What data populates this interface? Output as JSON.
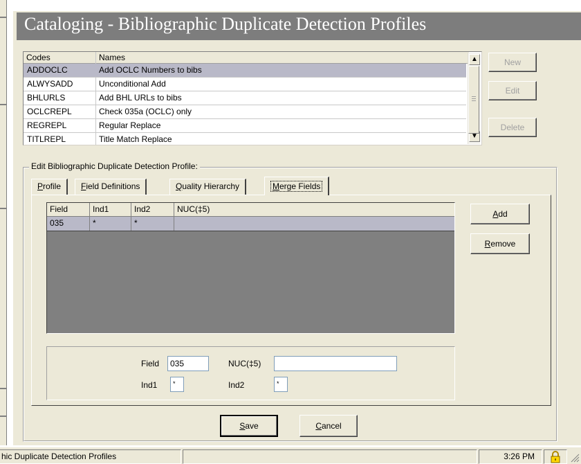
{
  "window": {
    "title": "Cataloging - Bibliographic Duplicate Detection Profiles"
  },
  "profiles_list": {
    "columns": [
      "Codes",
      "Names"
    ],
    "rows": [
      {
        "code": "ADDOCLC",
        "name": "Add OCLC Numbers to bibs",
        "selected": true
      },
      {
        "code": "ALWYSADD",
        "name": "Unconditional Add"
      },
      {
        "code": "BHLURLS",
        "name": "Add BHL URLs to bibs"
      },
      {
        "code": "OCLCREPL",
        "name": "Check 035a (OCLC) only"
      },
      {
        "code": "REGREPL",
        "name": "Regular Replace"
      },
      {
        "code": "TITLREPL",
        "name": "Title Match Replace"
      }
    ]
  },
  "list_buttons": {
    "new_label": "New",
    "edit_label": "Edit",
    "delete_label": "Delete"
  },
  "edit_group": {
    "label": "Edit  Bibliographic Duplicate Detection Profile:",
    "tabs": [
      {
        "label": "Profile",
        "accel": "P",
        "rest": "rofile"
      },
      {
        "label": "Field Definitions",
        "accel": "F",
        "rest": "ield Definitions"
      },
      {
        "label": "Quality Hierarchy",
        "accel": "Q",
        "rest": "uality Hierarchy"
      },
      {
        "label": "Merge Fields",
        "accel": "M",
        "rest": "erge Fields",
        "active": true
      }
    ]
  },
  "merge_grid": {
    "columns": [
      "Field",
      "Ind1",
      "Ind2",
      "NUC(‡5)"
    ],
    "rows": [
      {
        "field": "035",
        "ind1": "*",
        "ind2": "*",
        "nuc": ""
      }
    ]
  },
  "merge_buttons": {
    "add": {
      "accel": "A",
      "rest": "dd"
    },
    "remove": {
      "accel": "R",
      "rest": "emove"
    }
  },
  "detail": {
    "field_label": "Field",
    "field_value": "035",
    "nuc_label": "NUC(‡5)",
    "nuc_value": "",
    "ind1_label": "Ind1",
    "ind1_value": "*",
    "ind2_label": "Ind2",
    "ind2_value": "*"
  },
  "footer_buttons": {
    "save": {
      "accel": "S",
      "rest": "ave"
    },
    "cancel": {
      "accel": "C",
      "rest": "ancel"
    }
  },
  "status_bar": {
    "text": "hic Duplicate Detection Profiles",
    "time": "3:26 PM",
    "icons": [
      "lock-icon",
      "resize-grip-icon"
    ]
  },
  "colors": {
    "title_bar": "#7d7d7d",
    "selection": "#b9b9c8",
    "grid_background": "#808080",
    "window_face": "#ece9d8"
  }
}
